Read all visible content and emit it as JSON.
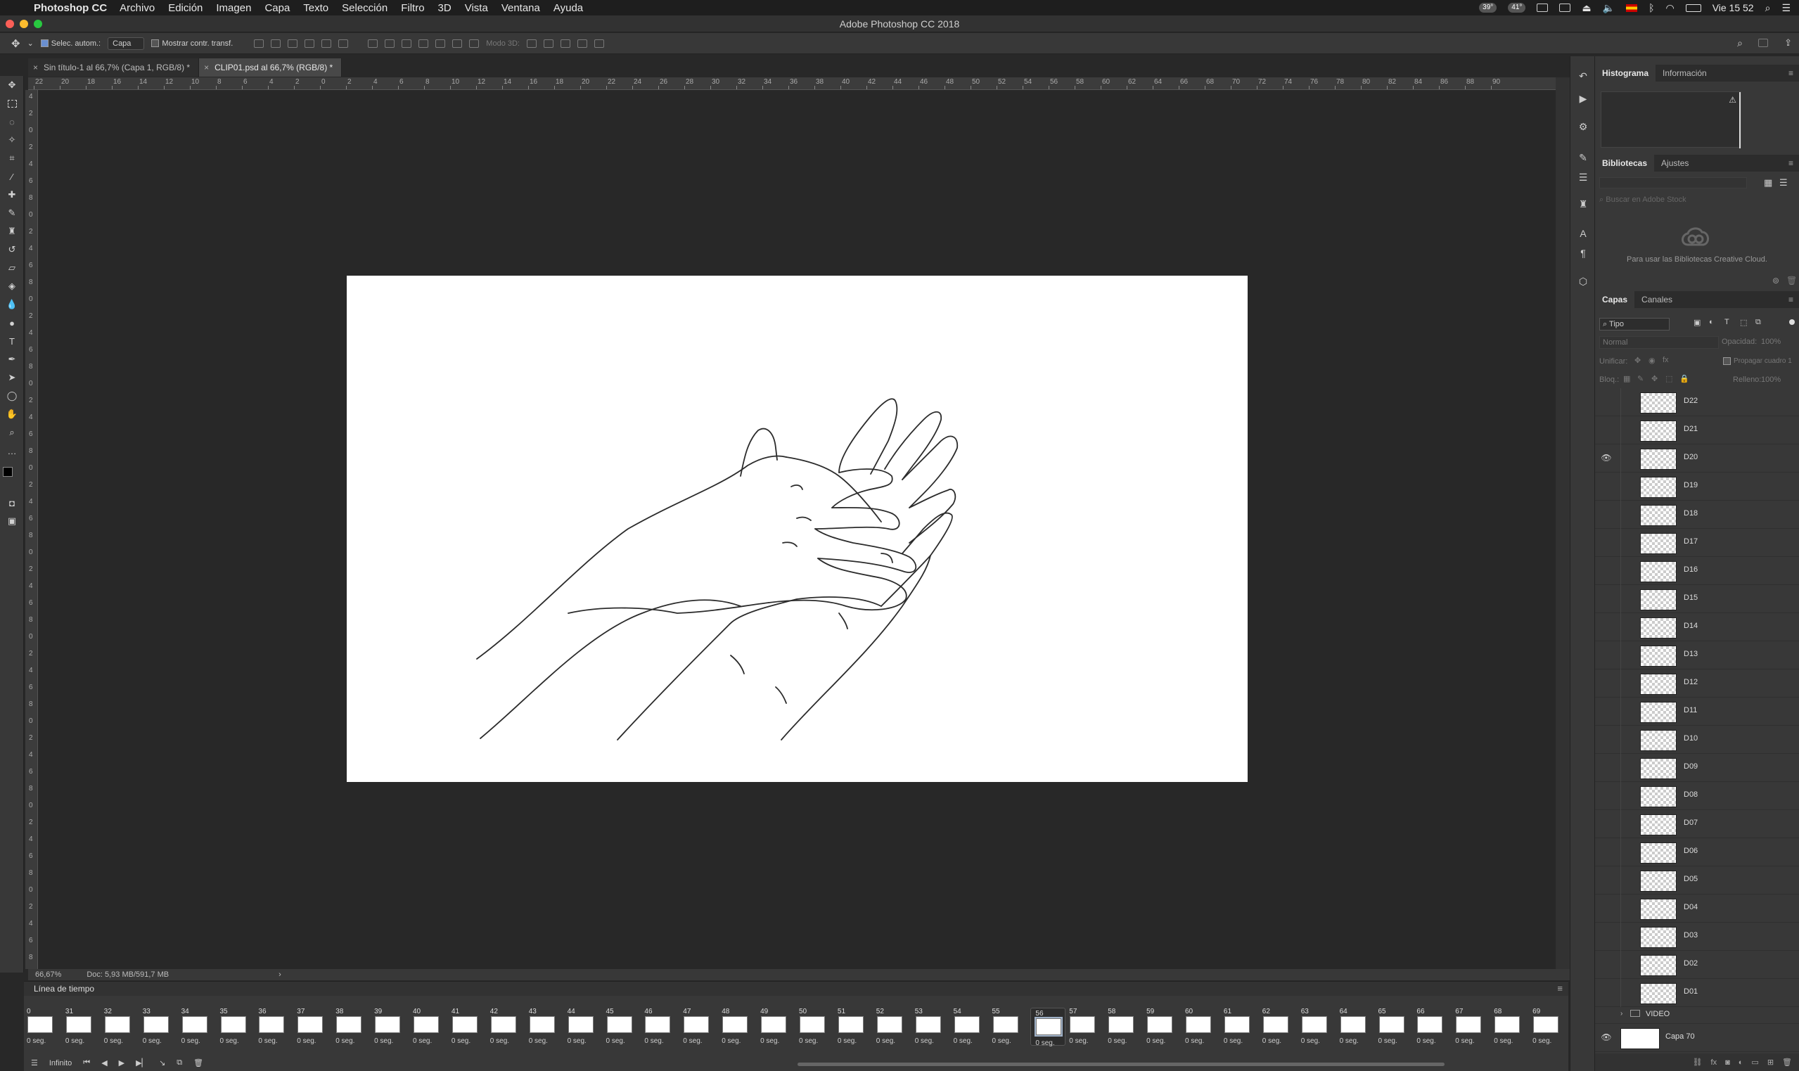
{
  "menubar": {
    "app": "Photoshop CC",
    "items": [
      "Archivo",
      "Edición",
      "Imagen",
      "Capa",
      "Texto",
      "Selección",
      "Filtro",
      "3D",
      "Vista",
      "Ventana",
      "Ayuda"
    ],
    "temp1": "39°",
    "temp2": "41°",
    "clock": "Vie 15 52"
  },
  "window": {
    "title": "Adobe Photoshop CC 2018"
  },
  "options": {
    "auto_select_label": "Selec. autom.:",
    "auto_select_value": "Capa",
    "transform_label": "Mostrar contr. transf.",
    "mode3d_label": "Modo 3D:"
  },
  "tabs": [
    {
      "label": "Sin título-1 al 66,7% (Capa 1, RGB/8) *"
    },
    {
      "label": "CLIP01.psd al 66,7% (RGB/8) *"
    }
  ],
  "ruler": {
    "top": [
      "22",
      "20",
      "18",
      "16",
      "14",
      "12",
      "10",
      "8",
      "6",
      "4",
      "2",
      "0",
      "2",
      "4",
      "6",
      "8",
      "10",
      "12",
      "14",
      "16",
      "18",
      "20",
      "22",
      "24",
      "26",
      "28",
      "30",
      "32",
      "34",
      "36",
      "38",
      "40",
      "42",
      "44",
      "46",
      "48",
      "50",
      "52",
      "54",
      "56",
      "58",
      "60",
      "62",
      "64",
      "66",
      "68",
      "70",
      "72",
      "74",
      "76",
      "78",
      "80",
      "82",
      "84",
      "86",
      "88",
      "90"
    ],
    "left": [
      "4",
      "2",
      "0",
      "2",
      "4",
      "6",
      "8",
      "0",
      "2",
      "4",
      "6",
      "8",
      "0",
      "2",
      "4",
      "6",
      "8",
      "0",
      "2",
      "4",
      "6",
      "8",
      "0",
      "2",
      "4",
      "6",
      "8",
      "0",
      "2",
      "4",
      "6",
      "8",
      "0",
      "2",
      "4",
      "6",
      "8",
      "0",
      "2",
      "4",
      "6",
      "8",
      "0",
      "2",
      "4",
      "6",
      "8",
      "0",
      "2",
      "4",
      "6",
      "8",
      "0",
      "2"
    ]
  },
  "status": {
    "zoom": "66,67%",
    "doc": "Doc: 5,93 MB/591,7 MB"
  },
  "timeline": {
    "title": "Línea de tiempo",
    "frames": [
      "0",
      "31",
      "32",
      "33",
      "34",
      "35",
      "36",
      "37",
      "38",
      "39",
      "40",
      "41",
      "42",
      "43",
      "44",
      "45",
      "46",
      "47",
      "48",
      "49",
      "50",
      "51",
      "52",
      "53",
      "54",
      "55",
      "56",
      "57",
      "58",
      "59",
      "60",
      "61",
      "62",
      "63",
      "64",
      "65",
      "66",
      "67",
      "68",
      "69"
    ],
    "duration": "0 seg.",
    "selected_frame": "56",
    "loop": "Infinito"
  },
  "panels": {
    "histogram_tabs": [
      "Histograma",
      "Información"
    ],
    "library_tabs": [
      "Bibliotecas",
      "Ajustes"
    ],
    "library_search": "Buscar en Adobe Stock",
    "library_message": "Para usar las Bibliotecas Creative Cloud.",
    "layers_tabs": [
      "Capas",
      "Canales"
    ],
    "filter_kind": "Tipo",
    "blend_mode": "Normal",
    "opacity_label": "Opacidad:",
    "opacity_value": "100%",
    "unify_label": "Unificar:",
    "propagate_label": "Propagar cuadro 1",
    "lock_label": "Bloq.:",
    "fill_label": "Relleno:",
    "fill_value": "100%",
    "layers": [
      "D22",
      "D21",
      "D20",
      "D19",
      "D18",
      "D17",
      "D16",
      "D15",
      "D14",
      "D13",
      "D12",
      "D11",
      "D10",
      "D09",
      "D08",
      "D07",
      "D06",
      "D05",
      "D04",
      "D03",
      "D02",
      "D01"
    ],
    "visible_layer": "D20",
    "group": "VIDEO",
    "background_layer": "Capa 70"
  }
}
